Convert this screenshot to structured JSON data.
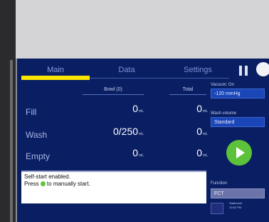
{
  "tabs": {
    "main": "Main",
    "data": "Data",
    "settings": "Settings"
  },
  "table": {
    "headers": {
      "bowl": "Bowl (0)",
      "total": "Total"
    },
    "rows": [
      {
        "label": "Fill",
        "bowl": "0",
        "bowl_unit": "mL",
        "total": "0",
        "total_unit": "mL"
      },
      {
        "label": "Wash",
        "bowl": "0/250",
        "bowl_unit": "mL",
        "total": "0",
        "total_unit": "mL"
      },
      {
        "label": "Empty",
        "bowl": "0",
        "bowl_unit": "mL",
        "total": "0",
        "total_unit": "mL"
      }
    ]
  },
  "message": {
    "line1": "Self-start enabled.",
    "line2_before": "Press",
    "line2_after": "to manually start."
  },
  "side": {
    "vacuum_label": "Vacuum: On",
    "vacuum_value": "-120 mmHg",
    "wash_label": "Wash volume",
    "wash_value": "Standard",
    "function_label": "Function",
    "function_value": "FCT",
    "status_line1": "Statement",
    "status_line2": "10:52 PM"
  },
  "colors": {
    "accent": "#ffe600",
    "play": "#5cc23a",
    "screen_bg": "#0a1f63"
  }
}
